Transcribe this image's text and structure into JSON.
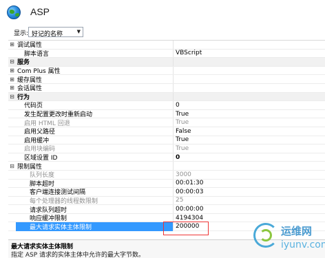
{
  "header": {
    "title": "ASP"
  },
  "toolbar": {
    "show_label": "显示:",
    "show_value": "好记的名称"
  },
  "rows": [
    {
      "exp": "⊞",
      "name": "调试属性",
      "value": "",
      "cls": ""
    },
    {
      "exp": "",
      "name": "脚本语言",
      "value": "VBScript",
      "cls": "indent1"
    },
    {
      "exp": "⊟",
      "name": "服务",
      "value": "",
      "cls": "cat"
    },
    {
      "exp": "⊞",
      "name": "Com Plus 属性",
      "value": "",
      "cls": ""
    },
    {
      "exp": "⊞",
      "name": "缓存属性",
      "value": "",
      "cls": ""
    },
    {
      "exp": "⊞",
      "name": "会话属性",
      "value": "",
      "cls": ""
    },
    {
      "exp": "⊟",
      "name": "行为",
      "value": "",
      "cls": "cat"
    },
    {
      "exp": "",
      "name": "代码页",
      "value": "0",
      "cls": "indent1"
    },
    {
      "exp": "",
      "name": "发生配置更改时重新启动",
      "value": "True",
      "cls": "indent1"
    },
    {
      "exp": "",
      "name": "启用 HTML 回退",
      "value": "True",
      "cls": "indent1 muted"
    },
    {
      "exp": "",
      "name": "启用父路径",
      "value": "False",
      "cls": "indent1"
    },
    {
      "exp": "",
      "name": "启用缓冲",
      "value": "True",
      "cls": "indent1"
    },
    {
      "exp": "",
      "name": "启用块编码",
      "value": "True",
      "cls": "indent1 muted"
    },
    {
      "exp": "",
      "name": "区域设置 ID",
      "value": "0",
      "cls": "indent1 bold"
    },
    {
      "exp": "⊟",
      "name": "限制属性",
      "value": "",
      "cls": ""
    },
    {
      "exp": "",
      "name": "队列长度",
      "value": "3000",
      "cls": "indent2 muted"
    },
    {
      "exp": "",
      "name": "脚本超时",
      "value": "00:01:30",
      "cls": "indent2"
    },
    {
      "exp": "",
      "name": "客户端连接测试间隔",
      "value": "00:00:03",
      "cls": "indent2"
    },
    {
      "exp": "",
      "name": "每个处理器的线程数限制",
      "value": "25",
      "cls": "indent2 muted"
    },
    {
      "exp": "",
      "name": "请求队列超时",
      "value": "00:00:00",
      "cls": "indent2"
    },
    {
      "exp": "",
      "name": "响应缓冲限制",
      "value": "4194304",
      "cls": "indent2"
    },
    {
      "exp": "",
      "name": "最大请求实体主体限制",
      "value": "200000",
      "cls": "indent2 selected"
    }
  ],
  "description": {
    "title": "最大请求实体主体限制",
    "text": "指定 ASP 请求的实体主体中允许的最大字节数。"
  },
  "watermark": {
    "cn": "运维网",
    "url": "iyunv.com"
  }
}
